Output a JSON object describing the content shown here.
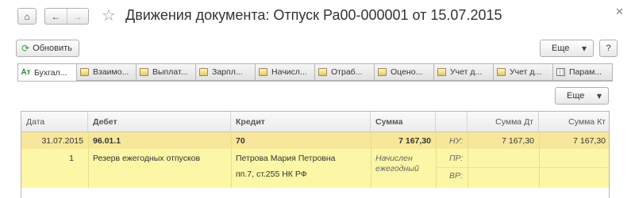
{
  "window": {
    "title": "Движения документа: Отпуск Ра00-000001 от 15.07.2015"
  },
  "commands": {
    "refresh": "Обновить",
    "more": "Еще",
    "help": "?"
  },
  "tabs": [
    {
      "label": "Бухгал...",
      "icon": "accounting-icon",
      "active": true
    },
    {
      "label": "Взаимо...",
      "icon": "register-icon"
    },
    {
      "label": "Выплат...",
      "icon": "register-icon"
    },
    {
      "label": "Зарпл...",
      "icon": "register-icon"
    },
    {
      "label": "Начисл...",
      "icon": "register-icon"
    },
    {
      "label": "Отраб...",
      "icon": "register-icon"
    },
    {
      "label": "Оцено...",
      "icon": "register-icon"
    },
    {
      "label": "Учет д...",
      "icon": "register-icon"
    },
    {
      "label": "Учет д...",
      "icon": "register-icon"
    },
    {
      "label": "Парам...",
      "icon": "table-icon"
    }
  ],
  "table": {
    "more": "Еще",
    "headers": {
      "date": "Дата",
      "debit": "Дебет",
      "credit": "Кредит",
      "sum": "Сумма",
      "sum_dt": "Сумма Дт",
      "sum_kt": "Сумма Кт"
    },
    "row": {
      "date": "31.07.2015",
      "debit_account": "96.01.1",
      "credit_account": "70",
      "sum": "7 167,30",
      "nu_label": "НУ:",
      "sum_dt": "7 167,30",
      "sum_kt": "7 167,30",
      "number": "1",
      "debit_subconto": "Резерв ежегодных отпусков",
      "credit_subconto1": "Петрова Мария Петровна",
      "credit_subconto2": "пп.7, ст.255 НК РФ",
      "content_line1": "Начислен",
      "content_line2": "ежегодный",
      "pr_label": "ПР:",
      "vr_label": "ВР:"
    }
  },
  "colors": {
    "row_highlight": "#f8e79a",
    "row_background": "#fbf7a6",
    "refresh_icon": "#2a9a3a"
  }
}
